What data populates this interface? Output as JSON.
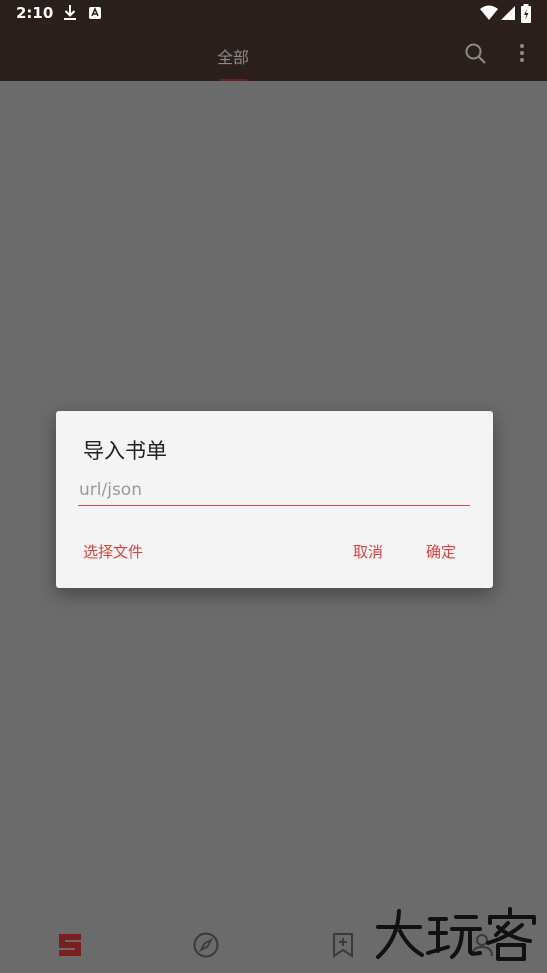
{
  "status_bar": {
    "time": "2:10",
    "icons": [
      "download-icon",
      "a-notification-icon",
      "wifi-icon",
      "signal-icon",
      "battery-icon"
    ]
  },
  "app_bar": {
    "tab_label": "全部",
    "actions": [
      "search-icon",
      "more-vert-icon"
    ]
  },
  "dialog": {
    "title": "导入书单",
    "input_value": "",
    "input_placeholder": "url/json",
    "select_file_label": "选择文件",
    "cancel_label": "取消",
    "confirm_label": "确定"
  },
  "bottom_nav": {
    "items": [
      "bookshelf-icon",
      "compass-icon",
      "bookmark-add-icon",
      "person-icon"
    ]
  },
  "watermark_text": "大玩客",
  "colors": {
    "accent": "#d9443f",
    "status_bar_bg": "#2b1f1c",
    "scrim": "#6b6b6b",
    "dialog_bg": "#f4f4f4"
  }
}
